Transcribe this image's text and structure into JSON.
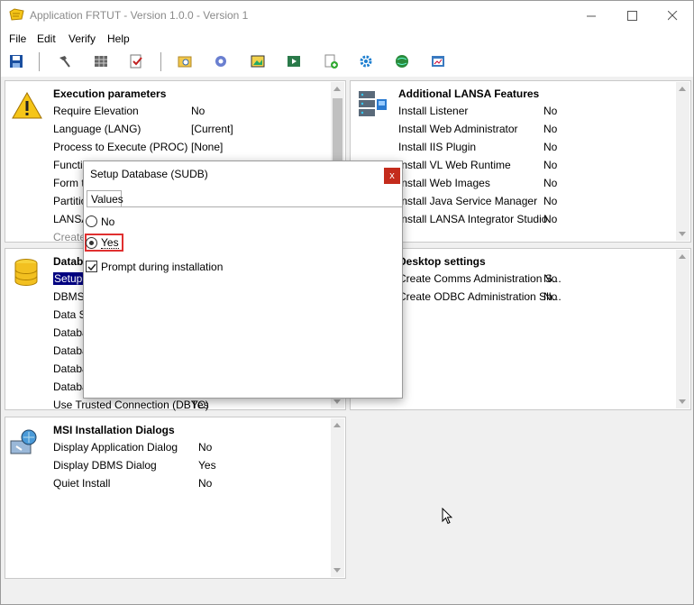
{
  "window": {
    "title": "Application FRTUT - Version 1.0.0 - Version 1",
    "minimize": "—",
    "maximize": "☐",
    "close": "✕"
  },
  "menu": {
    "file": "File",
    "edit": "Edit",
    "verify": "Verify",
    "help": "Help"
  },
  "panels": {
    "execution": {
      "title": "Execution parameters",
      "rows": [
        {
          "label": "Require Elevation",
          "value": "No"
        },
        {
          "label": "Language (LANG)",
          "value": "[Current]"
        },
        {
          "label": "Process to Execute (PROC)",
          "value": "[None]"
        },
        {
          "label": "Functio",
          "value": ""
        },
        {
          "label": "Form to",
          "value": ""
        },
        {
          "label": "Partitio",
          "value": ""
        },
        {
          "label": "LANSA",
          "value": ""
        },
        {
          "label": "Create",
          "value": ""
        }
      ]
    },
    "additional": {
      "title": "Additional LANSA Features",
      "rows": [
        {
          "label": "Install Listener",
          "value": "No"
        },
        {
          "label": "Install Web Administrator",
          "value": "No"
        },
        {
          "label": "Install IIS Plugin",
          "value": "No"
        },
        {
          "label": "Install VL Web Runtime",
          "value": "No"
        },
        {
          "label": "Install Web Images",
          "value": "No"
        },
        {
          "label": "Install Java Service Manager",
          "value": "No"
        },
        {
          "label": "Install LANSA Integrator Studio",
          "value": "No"
        }
      ]
    },
    "database": {
      "title": "Datab",
      "rows": [
        {
          "label": "Setup D",
          "value": ""
        },
        {
          "label": "DBMS T",
          "value": ""
        },
        {
          "label": "Data S",
          "value": ""
        },
        {
          "label": "Databa",
          "value": ""
        },
        {
          "label": "Databa",
          "value": ""
        },
        {
          "label": "Databa",
          "value": ""
        },
        {
          "label": "Databa",
          "value": ""
        },
        {
          "label": "Use Trusted Connection (DBTC)",
          "value": "Yes"
        }
      ]
    },
    "desktop": {
      "title": "Desktop settings",
      "rows": [
        {
          "label": "Create Comms Administration S...",
          "value": "No"
        },
        {
          "label": "Create ODBC Administration Sh...",
          "value": "No"
        }
      ]
    },
    "msi": {
      "title": "MSI Installation Dialogs",
      "rows": [
        {
          "label": "Display Application Dialog",
          "value": "No"
        },
        {
          "label": "Display DBMS Dialog",
          "value": "Yes"
        },
        {
          "label": "Quiet Install",
          "value": "No"
        }
      ]
    }
  },
  "dialog": {
    "title": "Setup Database (SUDB)",
    "close": "x",
    "tab": "Values",
    "option_no": "No",
    "option_yes": "Yes",
    "selected": "Yes",
    "prompt_label": "Prompt during installation",
    "prompt_checked": true
  },
  "colors": {
    "selection": "#000080",
    "close_red": "#c42b1c",
    "highlight": "#e03030"
  }
}
